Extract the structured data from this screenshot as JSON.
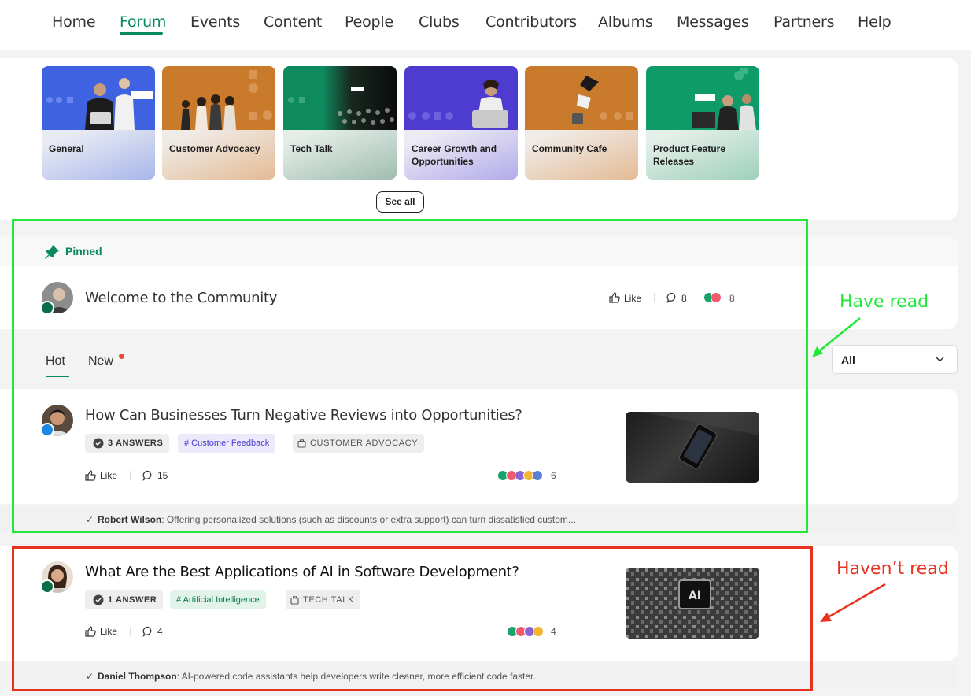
{
  "nav": {
    "items": [
      {
        "label": "Home"
      },
      {
        "label": "Forum"
      },
      {
        "label": "Events"
      },
      {
        "label": "Content"
      },
      {
        "label": "People"
      },
      {
        "label": "Clubs"
      },
      {
        "label": "Contributors"
      },
      {
        "label": "Albums"
      },
      {
        "label": "Messages"
      },
      {
        "label": "Partners"
      },
      {
        "label": "Help"
      }
    ],
    "active": "Forum"
  },
  "categories": [
    {
      "label": "General",
      "theme": "#3f62e0"
    },
    {
      "label": "Customer Advocacy",
      "theme": "#c97a2b"
    },
    {
      "label": "Tech Talk",
      "theme": "#0e8a5f"
    },
    {
      "label": "Career Growth and Opportunities",
      "theme": "#4d3ccf"
    },
    {
      "label": "Community Cafe",
      "theme": "#c97a2b"
    },
    {
      "label": "Product Feature Releases",
      "theme": "#0e9b67"
    }
  ],
  "see_all_label": "See all",
  "pinned": {
    "label": "Pinned",
    "post": {
      "title": "Welcome to the Community",
      "like_label": "Like",
      "comments": "8",
      "reactions": "8"
    }
  },
  "tabs": [
    {
      "label": "Hot"
    },
    {
      "label": "New"
    }
  ],
  "filter": {
    "selected": "All"
  },
  "posts": [
    {
      "title": "How Can Businesses Turn Negative Reviews into Opportunities?",
      "answers": "3 ANSWERS",
      "tag": "# Customer Feedback",
      "category": "CUSTOMER ADVOCACY",
      "like_label": "Like",
      "comments": "15",
      "reactions": "6",
      "reply_author": "Robert Wilson",
      "reply_text": ": Offering personalized solutions (such as discounts or extra support) can turn dissatisfied custom..."
    },
    {
      "title": "What Are the Best Applications of AI in Software Development?",
      "answers": "1 ANSWER",
      "tag": "# Artificial Intelligence",
      "category": "TECH TALK",
      "like_label": "Like",
      "comments": "4",
      "reactions": "4",
      "reply_author": "Daniel Thompson",
      "reply_text": ": AI-powered code assistants help developers write cleaner, more efficient code faster."
    }
  ],
  "annotations": {
    "read": "Have read",
    "unread": "Haven’t read"
  },
  "colors": {
    "accent": "#0a8a5c",
    "read_box": "#22e83a",
    "unread_box": "#e8321f"
  }
}
